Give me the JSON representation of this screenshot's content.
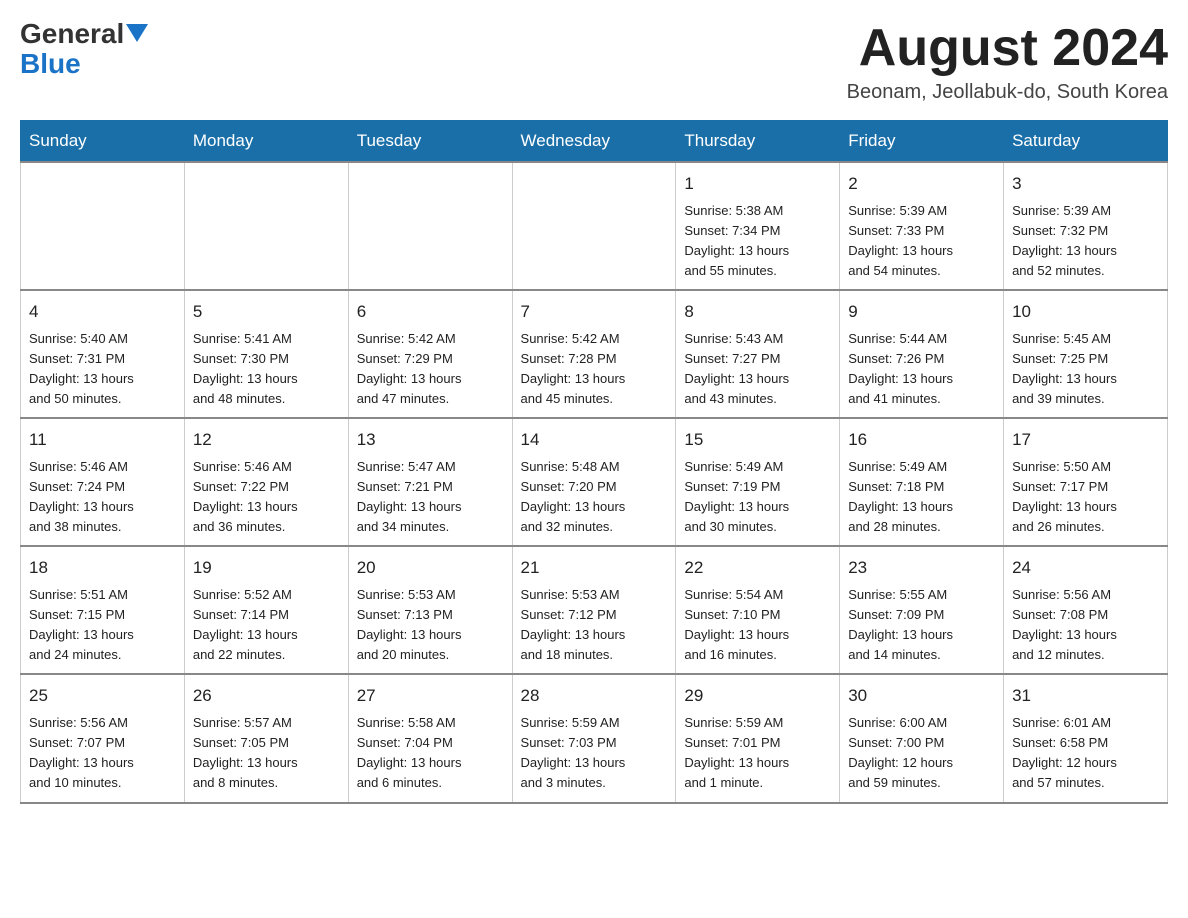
{
  "logo": {
    "text_general": "General",
    "text_blue": "Blue",
    "arrow": "▲"
  },
  "title": "August 2024",
  "location": "Beonam, Jeollabuk-do, South Korea",
  "weekdays": [
    "Sunday",
    "Monday",
    "Tuesday",
    "Wednesday",
    "Thursday",
    "Friday",
    "Saturday"
  ],
  "weeks": [
    [
      {
        "day": "",
        "info": ""
      },
      {
        "day": "",
        "info": ""
      },
      {
        "day": "",
        "info": ""
      },
      {
        "day": "",
        "info": ""
      },
      {
        "day": "1",
        "info": "Sunrise: 5:38 AM\nSunset: 7:34 PM\nDaylight: 13 hours\nand 55 minutes."
      },
      {
        "day": "2",
        "info": "Sunrise: 5:39 AM\nSunset: 7:33 PM\nDaylight: 13 hours\nand 54 minutes."
      },
      {
        "day": "3",
        "info": "Sunrise: 5:39 AM\nSunset: 7:32 PM\nDaylight: 13 hours\nand 52 minutes."
      }
    ],
    [
      {
        "day": "4",
        "info": "Sunrise: 5:40 AM\nSunset: 7:31 PM\nDaylight: 13 hours\nand 50 minutes."
      },
      {
        "day": "5",
        "info": "Sunrise: 5:41 AM\nSunset: 7:30 PM\nDaylight: 13 hours\nand 48 minutes."
      },
      {
        "day": "6",
        "info": "Sunrise: 5:42 AM\nSunset: 7:29 PM\nDaylight: 13 hours\nand 47 minutes."
      },
      {
        "day": "7",
        "info": "Sunrise: 5:42 AM\nSunset: 7:28 PM\nDaylight: 13 hours\nand 45 minutes."
      },
      {
        "day": "8",
        "info": "Sunrise: 5:43 AM\nSunset: 7:27 PM\nDaylight: 13 hours\nand 43 minutes."
      },
      {
        "day": "9",
        "info": "Sunrise: 5:44 AM\nSunset: 7:26 PM\nDaylight: 13 hours\nand 41 minutes."
      },
      {
        "day": "10",
        "info": "Sunrise: 5:45 AM\nSunset: 7:25 PM\nDaylight: 13 hours\nand 39 minutes."
      }
    ],
    [
      {
        "day": "11",
        "info": "Sunrise: 5:46 AM\nSunset: 7:24 PM\nDaylight: 13 hours\nand 38 minutes."
      },
      {
        "day": "12",
        "info": "Sunrise: 5:46 AM\nSunset: 7:22 PM\nDaylight: 13 hours\nand 36 minutes."
      },
      {
        "day": "13",
        "info": "Sunrise: 5:47 AM\nSunset: 7:21 PM\nDaylight: 13 hours\nand 34 minutes."
      },
      {
        "day": "14",
        "info": "Sunrise: 5:48 AM\nSunset: 7:20 PM\nDaylight: 13 hours\nand 32 minutes."
      },
      {
        "day": "15",
        "info": "Sunrise: 5:49 AM\nSunset: 7:19 PM\nDaylight: 13 hours\nand 30 minutes."
      },
      {
        "day": "16",
        "info": "Sunrise: 5:49 AM\nSunset: 7:18 PM\nDaylight: 13 hours\nand 28 minutes."
      },
      {
        "day": "17",
        "info": "Sunrise: 5:50 AM\nSunset: 7:17 PM\nDaylight: 13 hours\nand 26 minutes."
      }
    ],
    [
      {
        "day": "18",
        "info": "Sunrise: 5:51 AM\nSunset: 7:15 PM\nDaylight: 13 hours\nand 24 minutes."
      },
      {
        "day": "19",
        "info": "Sunrise: 5:52 AM\nSunset: 7:14 PM\nDaylight: 13 hours\nand 22 minutes."
      },
      {
        "day": "20",
        "info": "Sunrise: 5:53 AM\nSunset: 7:13 PM\nDaylight: 13 hours\nand 20 minutes."
      },
      {
        "day": "21",
        "info": "Sunrise: 5:53 AM\nSunset: 7:12 PM\nDaylight: 13 hours\nand 18 minutes."
      },
      {
        "day": "22",
        "info": "Sunrise: 5:54 AM\nSunset: 7:10 PM\nDaylight: 13 hours\nand 16 minutes."
      },
      {
        "day": "23",
        "info": "Sunrise: 5:55 AM\nSunset: 7:09 PM\nDaylight: 13 hours\nand 14 minutes."
      },
      {
        "day": "24",
        "info": "Sunrise: 5:56 AM\nSunset: 7:08 PM\nDaylight: 13 hours\nand 12 minutes."
      }
    ],
    [
      {
        "day": "25",
        "info": "Sunrise: 5:56 AM\nSunset: 7:07 PM\nDaylight: 13 hours\nand 10 minutes."
      },
      {
        "day": "26",
        "info": "Sunrise: 5:57 AM\nSunset: 7:05 PM\nDaylight: 13 hours\nand 8 minutes."
      },
      {
        "day": "27",
        "info": "Sunrise: 5:58 AM\nSunset: 7:04 PM\nDaylight: 13 hours\nand 6 minutes."
      },
      {
        "day": "28",
        "info": "Sunrise: 5:59 AM\nSunset: 7:03 PM\nDaylight: 13 hours\nand 3 minutes."
      },
      {
        "day": "29",
        "info": "Sunrise: 5:59 AM\nSunset: 7:01 PM\nDaylight: 13 hours\nand 1 minute."
      },
      {
        "day": "30",
        "info": "Sunrise: 6:00 AM\nSunset: 7:00 PM\nDaylight: 12 hours\nand 59 minutes."
      },
      {
        "day": "31",
        "info": "Sunrise: 6:01 AM\nSunset: 6:58 PM\nDaylight: 12 hours\nand 57 minutes."
      }
    ]
  ]
}
